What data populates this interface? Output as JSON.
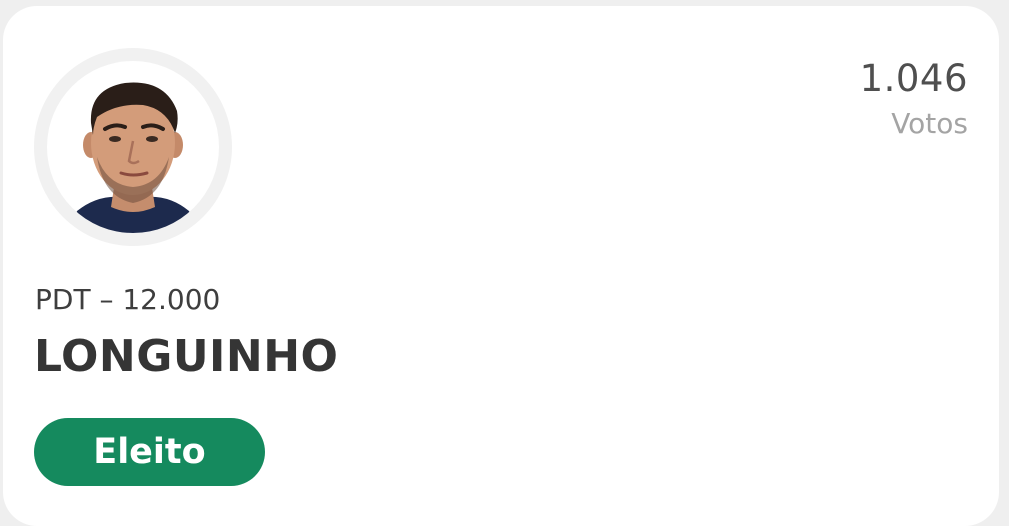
{
  "candidate": {
    "name": "LONGUINHO",
    "party_number": "PDT – 12.000",
    "votes_count": "1.046",
    "votes_label": "Votos",
    "status": "Eleito"
  },
  "colors": {
    "status_badge": "#158a5e",
    "name_text": "#353535",
    "votes_label_text": "#a4a4a4"
  }
}
